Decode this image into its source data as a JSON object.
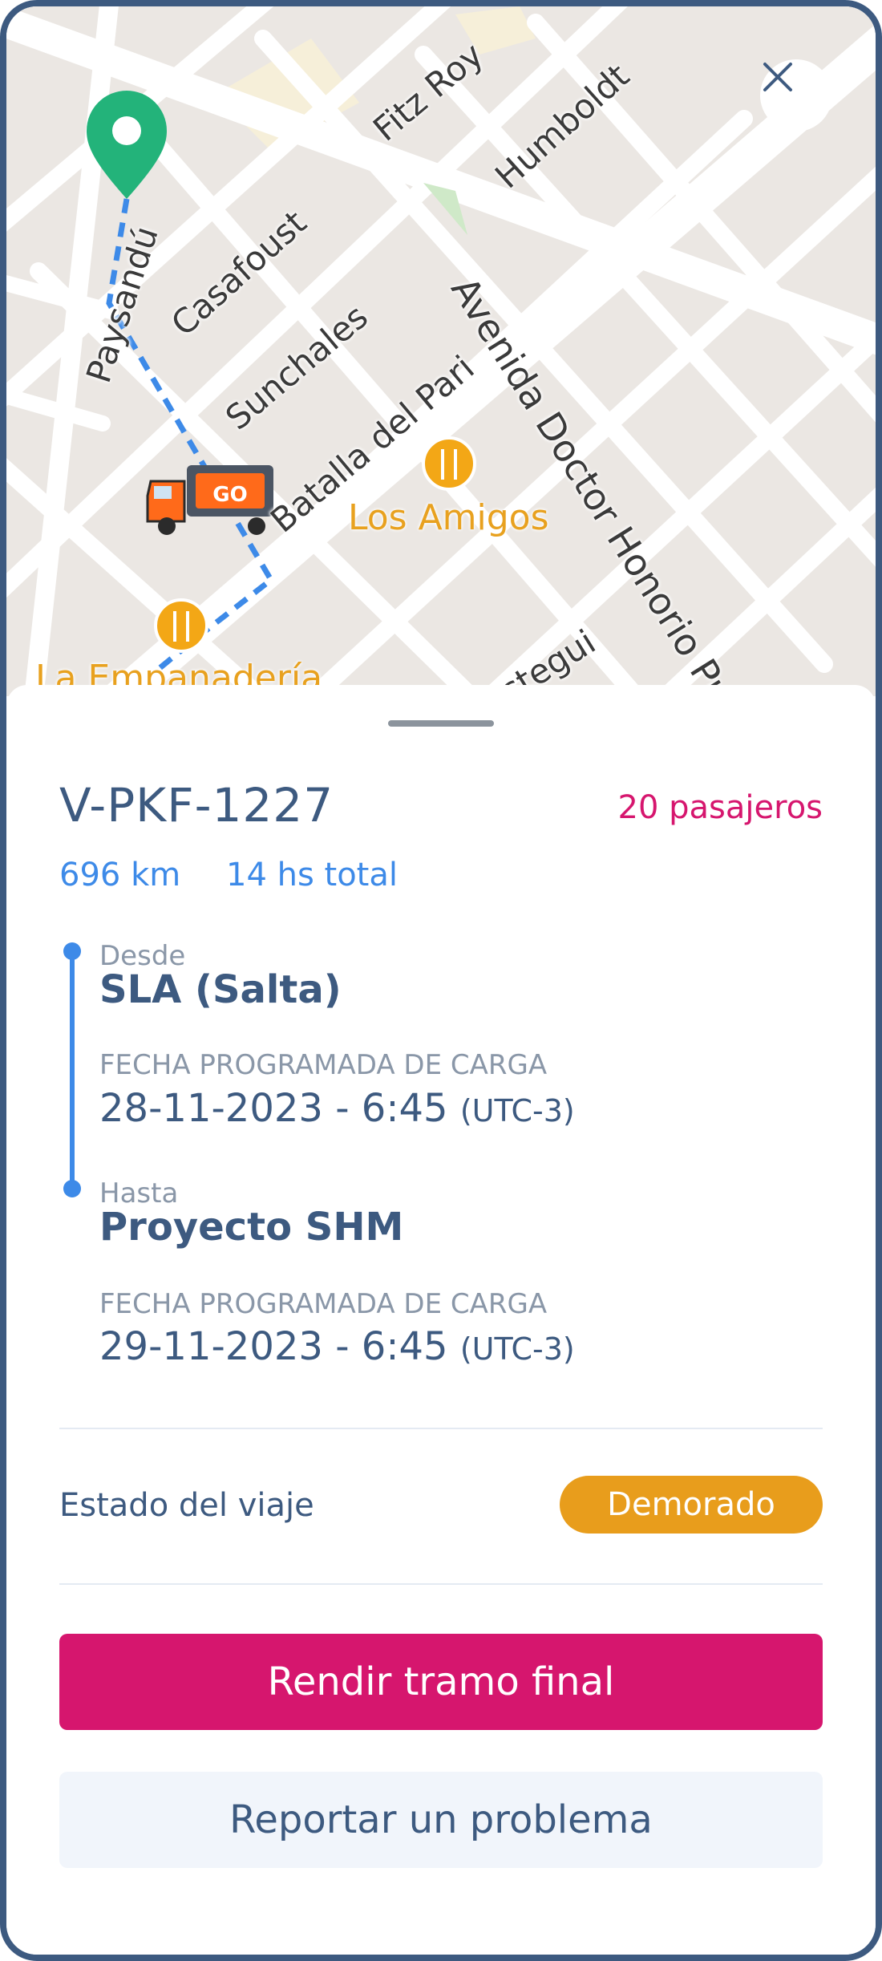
{
  "map": {
    "streets": [
      "Fitz Roy",
      "Humboldt",
      "Paysandú",
      "Casafoust",
      "Sunchales",
      "Batalla del Pari",
      "Avenida Doctor Honorio Pu",
      "ustegui"
    ],
    "places": [
      "Los Amigos",
      "La Empanadería"
    ],
    "close_icon": "close-icon",
    "pin_icon": "map-pin-icon",
    "vehicle_icon": "truck-icon",
    "restaurant_icon": "restaurant-icon",
    "route_color": "#3d8ae8",
    "pin_color": "#23b37a"
  },
  "trip": {
    "vehicle_id": "V-PKF-1227",
    "passengers": "20 pasajeros",
    "distance": "696 km",
    "duration": "14 hs total",
    "from": {
      "label": "Desde",
      "place": "SLA (Salta)",
      "date_caption": "FECHA PROGRAMADA DE CARGA",
      "date": "28-11-2023 - 6:45",
      "timezone": "(UTC-3)"
    },
    "to": {
      "label": "Hasta",
      "place": "Proyecto SHM",
      "date_caption": "FECHA PROGRAMADA DE CARGA",
      "date": "29-11-2023 - 6:45",
      "timezone": "(UTC-3)"
    },
    "status_label": "Estado del viaje",
    "status": "Demorado"
  },
  "actions": {
    "primary": "Rendir tramo final",
    "secondary": "Reportar un problema"
  },
  "colors": {
    "accent": "#d6166e",
    "primary_text": "#3d5a80",
    "link": "#3d8ae8",
    "status": "#e89d1c"
  }
}
